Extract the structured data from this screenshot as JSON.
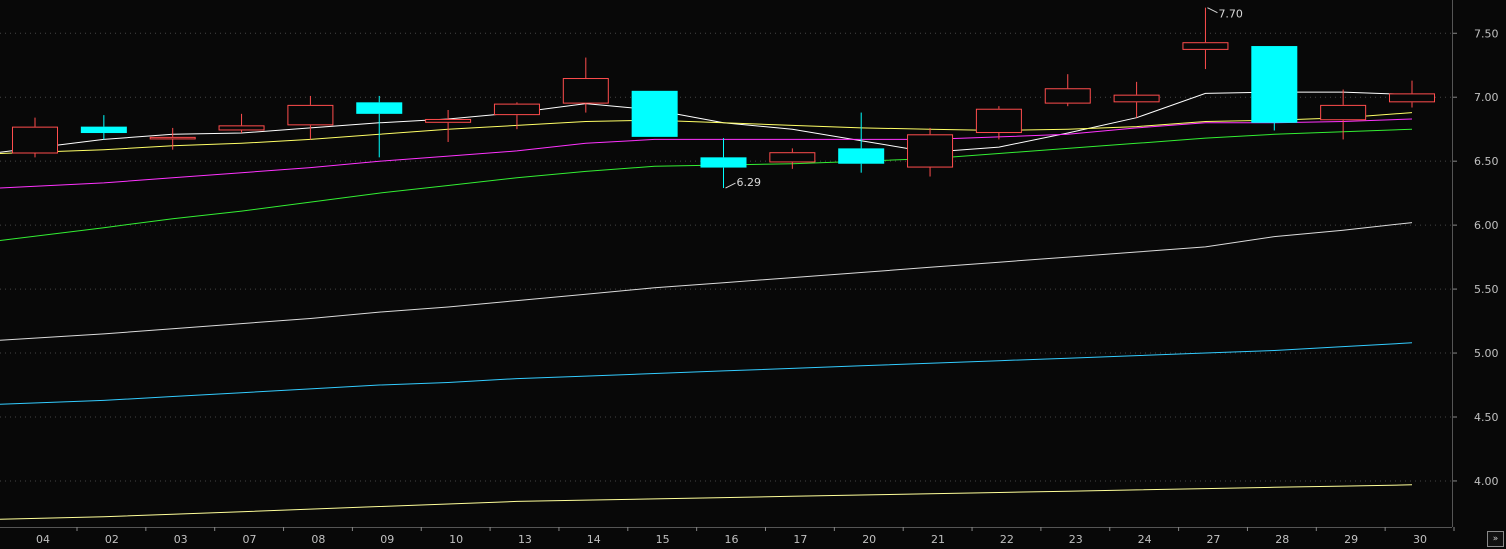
{
  "chart_data": {
    "type": "candlestick",
    "categories": [
      "04",
      "02",
      "03",
      "07",
      "08",
      "09",
      "10",
      "13",
      "14",
      "15",
      "16",
      "17",
      "20",
      "21",
      "22",
      "23",
      "24",
      "27",
      "28",
      "29",
      "30"
    ],
    "candles": [
      {
        "open": 6.56,
        "high": 6.84,
        "low": 6.53,
        "close": 6.77,
        "dir": "up"
      },
      {
        "open": 6.77,
        "high": 6.86,
        "low": 6.67,
        "close": 6.72,
        "dir": "down"
      },
      {
        "open": 6.67,
        "high": 6.76,
        "low": 6.59,
        "close": 6.69,
        "dir": "up"
      },
      {
        "open": 6.74,
        "high": 6.87,
        "low": 6.72,
        "close": 6.78,
        "dir": "up"
      },
      {
        "open": 6.78,
        "high": 7.01,
        "low": 6.67,
        "close": 6.94,
        "dir": "up"
      },
      {
        "open": 6.96,
        "high": 7.01,
        "low": 6.53,
        "close": 6.87,
        "dir": "down"
      },
      {
        "open": 6.8,
        "high": 6.9,
        "low": 6.65,
        "close": 6.83,
        "dir": "up"
      },
      {
        "open": 6.86,
        "high": 6.96,
        "low": 6.75,
        "close": 6.95,
        "dir": "up"
      },
      {
        "open": 6.95,
        "high": 7.31,
        "low": 6.88,
        "close": 7.15,
        "dir": "up"
      },
      {
        "open": 7.05,
        "high": 7.05,
        "low": 6.69,
        "close": 6.69,
        "dir": "down"
      },
      {
        "open": 6.53,
        "high": 6.68,
        "low": 6.29,
        "close": 6.45,
        "dir": "down"
      },
      {
        "open": 6.49,
        "high": 6.6,
        "low": 6.44,
        "close": 6.57,
        "dir": "up"
      },
      {
        "open": 6.6,
        "high": 6.88,
        "low": 6.41,
        "close": 6.48,
        "dir": "down"
      },
      {
        "open": 6.45,
        "high": 6.76,
        "low": 6.38,
        "close": 6.71,
        "dir": "up"
      },
      {
        "open": 6.72,
        "high": 6.93,
        "low": 6.67,
        "close": 6.91,
        "dir": "up"
      },
      {
        "open": 6.95,
        "high": 7.18,
        "low": 6.93,
        "close": 7.07,
        "dir": "up"
      },
      {
        "open": 6.96,
        "high": 7.12,
        "low": 6.84,
        "close": 7.02,
        "dir": "up"
      },
      {
        "open": 7.37,
        "high": 7.7,
        "low": 7.22,
        "close": 7.43,
        "dir": "up"
      },
      {
        "open": 7.4,
        "high": 7.4,
        "low": 6.74,
        "close": 6.8,
        "dir": "down"
      },
      {
        "open": 6.82,
        "high": 7.06,
        "low": 6.67,
        "close": 6.94,
        "dir": "up"
      },
      {
        "open": 6.96,
        "high": 7.13,
        "low": 6.92,
        "close": 7.03,
        "dir": "up"
      }
    ],
    "moving_averages": [
      {
        "color": "#ffffff",
        "values": [
          6.57,
          6.67,
          6.71,
          6.72,
          6.76,
          6.8,
          6.83,
          6.88,
          6.95,
          6.9,
          6.8,
          6.75,
          6.66,
          6.57,
          6.61,
          6.72,
          6.84,
          7.03,
          7.04,
          7.04,
          7.02
        ]
      },
      {
        "color": "#ffff66",
        "values": [
          6.56,
          6.59,
          6.62,
          6.64,
          6.67,
          6.71,
          6.75,
          6.78,
          6.81,
          6.82,
          6.8,
          6.78,
          6.76,
          6.75,
          6.74,
          6.75,
          6.77,
          6.81,
          6.82,
          6.84,
          6.88
        ]
      },
      {
        "color": "#ff33ff",
        "values": [
          6.29,
          6.33,
          6.37,
          6.41,
          6.45,
          6.5,
          6.54,
          6.58,
          6.64,
          6.67,
          6.67,
          6.67,
          6.67,
          6.67,
          6.69,
          6.71,
          6.76,
          6.8,
          6.8,
          6.81,
          6.83
        ]
      },
      {
        "color": "#33ee33",
        "values": [
          5.88,
          5.98,
          6.05,
          6.11,
          6.18,
          6.25,
          6.31,
          6.37,
          6.42,
          6.46,
          6.47,
          6.48,
          6.5,
          6.52,
          6.56,
          6.6,
          6.64,
          6.68,
          6.71,
          6.73,
          6.75
        ]
      },
      {
        "color": "#dcdcdc",
        "values": [
          5.1,
          5.15,
          5.19,
          5.23,
          5.27,
          5.32,
          5.36,
          5.41,
          5.46,
          5.51,
          5.55,
          5.59,
          5.63,
          5.67,
          5.71,
          5.75,
          5.79,
          5.83,
          5.91,
          5.96,
          6.02
        ]
      },
      {
        "color": "#33ccff",
        "values": [
          4.6,
          4.63,
          4.66,
          4.69,
          4.72,
          4.75,
          4.77,
          4.8,
          4.82,
          4.84,
          4.86,
          4.88,
          4.9,
          4.92,
          4.94,
          4.96,
          4.98,
          5.0,
          5.02,
          5.05,
          5.08
        ]
      },
      {
        "color": "#ffff99",
        "values": [
          3.7,
          3.72,
          3.74,
          3.76,
          3.78,
          3.8,
          3.82,
          3.84,
          3.85,
          3.86,
          3.87,
          3.88,
          3.89,
          3.9,
          3.91,
          3.92,
          3.93,
          3.94,
          3.95,
          3.96,
          3.97
        ]
      }
    ],
    "yticks": [
      4.0,
      4.5,
      5.0,
      5.5,
      6.0,
      6.5,
      7.0,
      7.5
    ],
    "ylim": [
      3.64,
      7.76
    ],
    "annotations": {
      "max_label": "7.70",
      "min_label": "6.29"
    },
    "colors": {
      "up": "#ff4d4d",
      "down": "#00ffff",
      "background": "#080808",
      "grid": "#444444",
      "axis": "#555555"
    },
    "grid": true
  },
  "ui": {
    "expand_label": "»"
  }
}
